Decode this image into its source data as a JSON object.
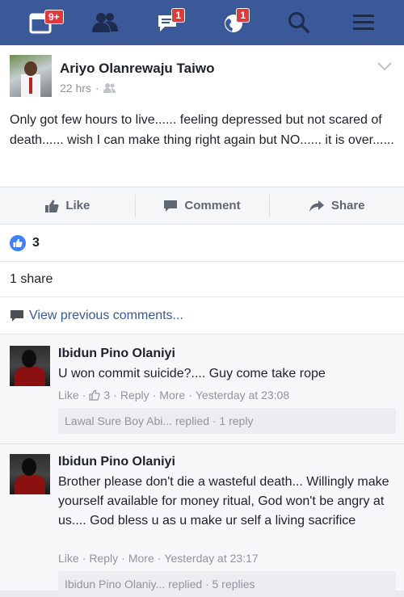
{
  "nav": {
    "notifications_badge": "9+",
    "messages_badge": "1",
    "globe_badge": "1",
    "icons": [
      "calendar-icon",
      "friends-icon",
      "messages-icon",
      "globe-icon",
      "search-icon",
      "menu-icon"
    ],
    "bar_color": "#3b5998"
  },
  "post": {
    "author": "Ariyo Olanrewaju Taiwo",
    "time": "22 hrs",
    "text": "Only got few hours to live...... feeling depressed but not scared of death...... wish I can make thing right again but NO...... it is over......"
  },
  "actions": {
    "like": "Like",
    "comment": "Comment",
    "share": "Share"
  },
  "reactions": {
    "count": "3"
  },
  "shares": {
    "text": "1 share"
  },
  "view_previous": "View previous comments...",
  "comments": [
    {
      "name": "Ibidun Pino Olaniyi",
      "text": "U won commit suicide?.... Guy come take rope",
      "like": "Like",
      "reactions": "3",
      "reply": "Reply",
      "more": "More",
      "time": "Yesterday at 23:08",
      "replies_summary": "Lawal Sure Boy Abi... replied · 1 reply"
    },
    {
      "name": "Ibidun Pino Olaniyi",
      "text": "Brother please don't die a wasteful death... Willingly make yourself available for money ritual, God won't be angry at us.... God bless u as u make ur self a living sacrifice",
      "like": "Like",
      "reply": "Reply",
      "more": "More",
      "time": "Yesterday at 23:17",
      "replies_summary": "Ibidun Pino Olaniy... replied · 5 replies"
    }
  ]
}
